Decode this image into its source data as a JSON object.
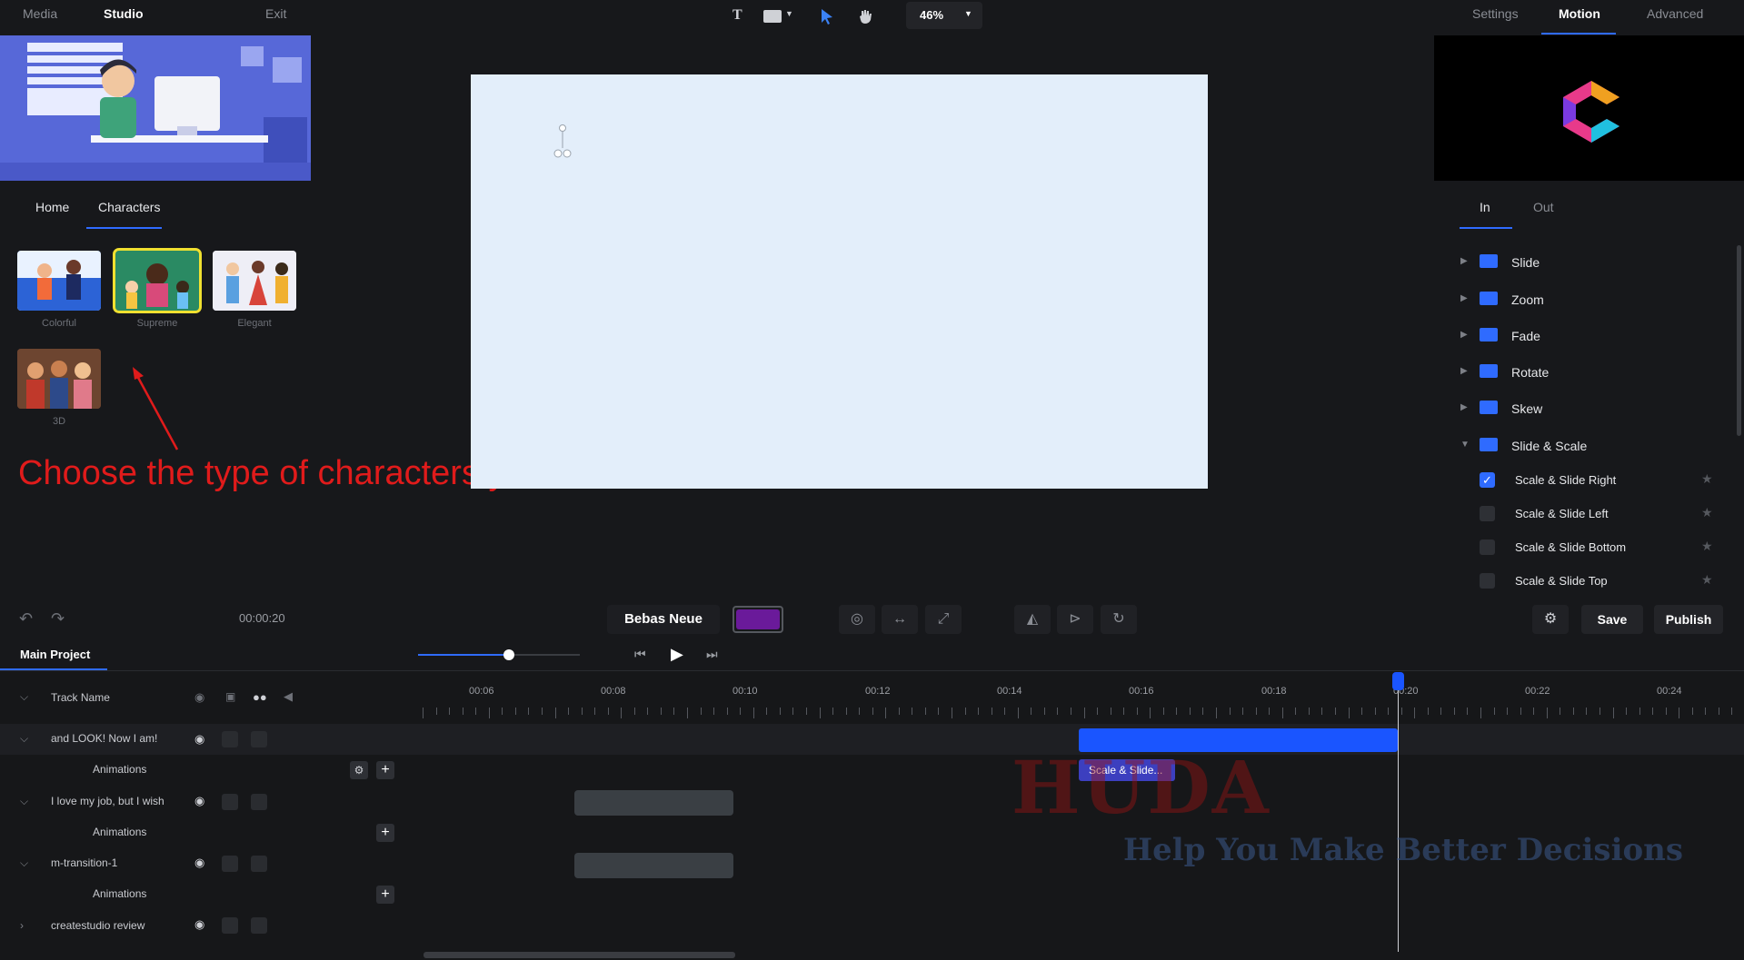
{
  "left_panel": {
    "tabs": [
      "Media",
      "Studio",
      "Exit"
    ],
    "subtabs": [
      "Home",
      "Characters"
    ],
    "characters": [
      {
        "label": "Colorful"
      },
      {
        "label": "Supreme",
        "selected": true
      },
      {
        "label": "Elegant"
      },
      {
        "label": "3D"
      }
    ],
    "instruction": "Choose the type of characters you want to add.",
    "colors": {
      "instruction": "#e01b1b",
      "selected_outline": "#f0e030"
    }
  },
  "toolbar": {
    "text_tool_icon": "T",
    "zoom_value": "46%"
  },
  "right_panel": {
    "tabs": [
      "Settings",
      "Motion",
      "Advanced"
    ],
    "inout_tabs": [
      "In",
      "Out"
    ],
    "folders": [
      "Slide",
      "Zoom",
      "Fade",
      "Rotate",
      "Skew",
      "Slide & Scale"
    ],
    "animations": [
      {
        "label": "Scale & Slide Right",
        "checked": true
      },
      {
        "label": "Scale & Slide Left",
        "checked": false
      },
      {
        "label": "Scale & Slide Bottom",
        "checked": false
      },
      {
        "label": "Scale & Slide Top",
        "checked": false
      }
    ]
  },
  "controls": {
    "time": "00:00:20",
    "font_name": "Bebas Neue",
    "color_swatch": "#6a1a9a",
    "save_label": "Save",
    "publish_label": "Publish",
    "playback_progress": 0.56
  },
  "timeline": {
    "project_tab": "Main Project",
    "header_label": "Track Name",
    "ticks": [
      "00:06",
      "00:08",
      "00:10",
      "00:12",
      "00:14",
      "00:16",
      "00:18",
      "00:20",
      "00:22",
      "00:24"
    ],
    "tracks": [
      {
        "name": "and LOOK! Now I am!",
        "sub": "Animations"
      },
      {
        "name": "I love my job, but I wish",
        "sub": "Animations"
      },
      {
        "name": "m-transition-1",
        "sub": "Animations"
      },
      {
        "name": "createstudio review"
      }
    ],
    "clip_label": "Scale & Slide...",
    "accent": "#1a55ff"
  },
  "watermark": {
    "title": "HUDA",
    "tagline": "Help You Make Better Decisions"
  }
}
